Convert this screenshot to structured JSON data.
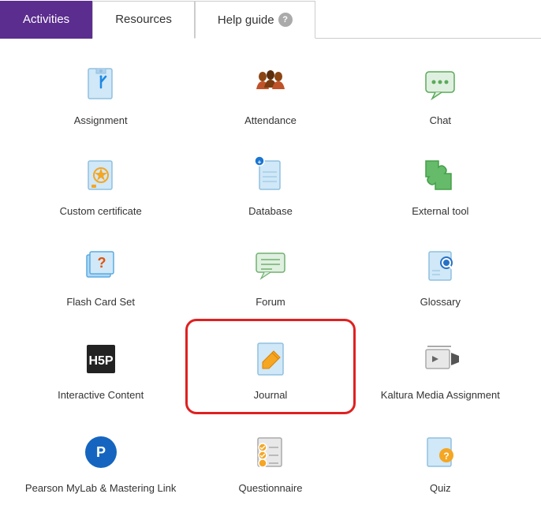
{
  "tabs": [
    {
      "id": "activities",
      "label": "Activities",
      "active": true
    },
    {
      "id": "resources",
      "label": "Resources",
      "active": false
    },
    {
      "id": "helpguide",
      "label": "Help guide",
      "active": false,
      "hasHelp": true
    }
  ],
  "activities": [
    {
      "id": "assignment",
      "label": "Assignment"
    },
    {
      "id": "attendance",
      "label": "Attendance"
    },
    {
      "id": "chat",
      "label": "Chat"
    },
    {
      "id": "custom-certificate",
      "label": "Custom certificate"
    },
    {
      "id": "database",
      "label": "Database"
    },
    {
      "id": "external-tool",
      "label": "External tool"
    },
    {
      "id": "flash-card-set",
      "label": "Flash Card Set"
    },
    {
      "id": "forum",
      "label": "Forum"
    },
    {
      "id": "glossary",
      "label": "Glossary"
    },
    {
      "id": "interactive-content",
      "label": "Interactive Content"
    },
    {
      "id": "journal",
      "label": "Journal",
      "highlighted": true
    },
    {
      "id": "kaltura-media-assignment",
      "label": "Kaltura Media Assignment"
    },
    {
      "id": "pearson-mylab",
      "label": "Pearson MyLab & Mastering Link"
    },
    {
      "id": "questionnaire",
      "label": "Questionnaire"
    },
    {
      "id": "quiz",
      "label": "Quiz"
    }
  ]
}
